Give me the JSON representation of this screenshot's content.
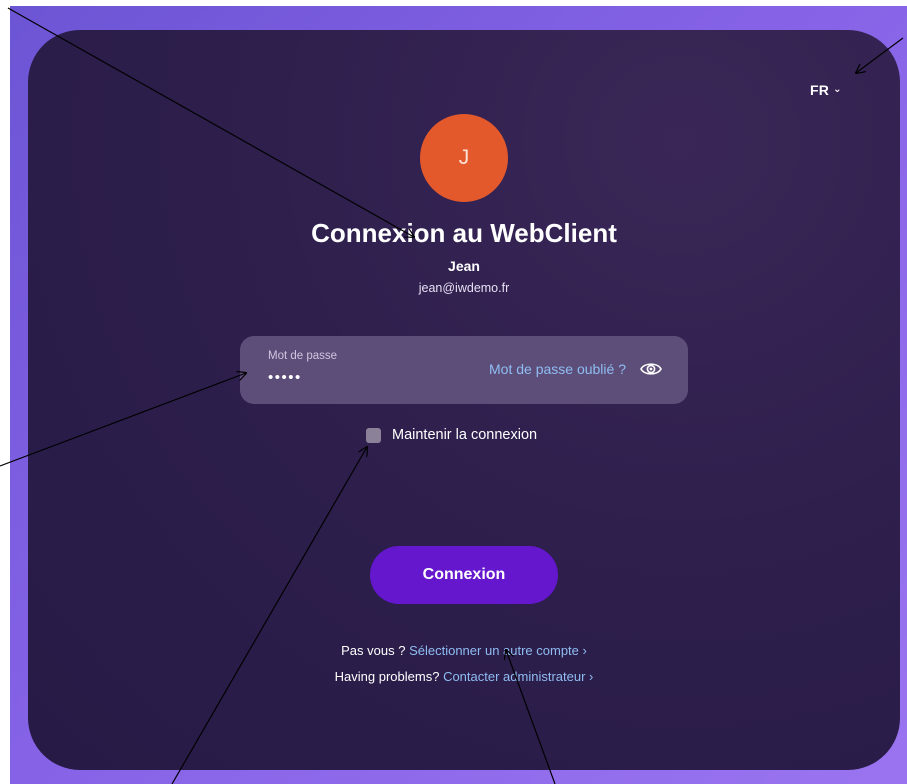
{
  "header": {
    "language": "FR"
  },
  "user": {
    "avatar_letter": "J",
    "name": "Jean",
    "email": "jean@iwdemo.fr"
  },
  "login": {
    "title": "Connexion au WebClient",
    "password_label": "Mot de passe",
    "password_value": "•••••",
    "forgot_link": "Mot de passe oublié ?",
    "remember_label": "Maintenir la connexion",
    "remember_checked": false,
    "submit_label": "Connexion"
  },
  "footer": {
    "not_you_text": "Pas vous ?",
    "select_account_link": "Sélectionner un autre compte ›",
    "problems_text": "Having problems?",
    "contact_admin_link": "Contacter administrateur ›"
  },
  "colors": {
    "card_background": "#2e1f4d",
    "backdrop": "#8562e6",
    "avatar": "#e4592c",
    "submit_button": "#6417cc",
    "link": "#8fbdf2",
    "annotation_arrow": "#000000"
  },
  "icons": {
    "language_chevron": "chevron-down-icon",
    "password_toggle": "eye-icon"
  }
}
